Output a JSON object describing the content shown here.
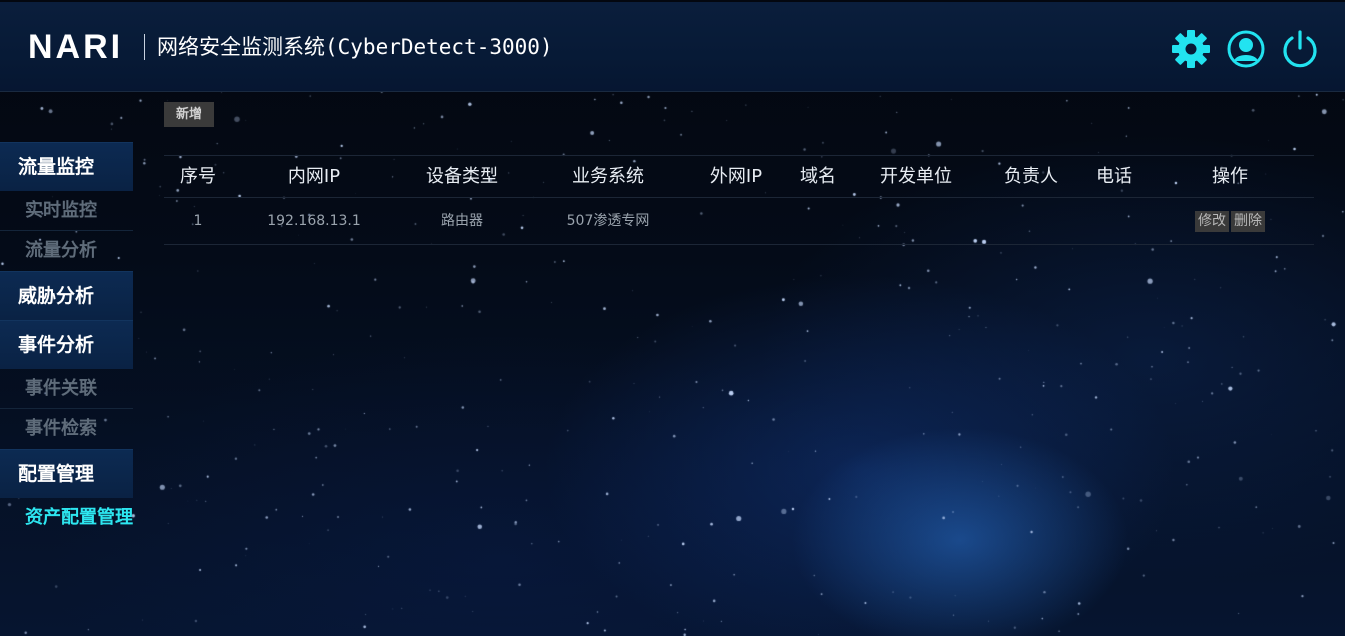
{
  "header": {
    "logo": "NARI",
    "title": "网络安全监测系统(CyberDetect-3000)",
    "icons": [
      "gear-icon",
      "user-icon",
      "power-icon"
    ]
  },
  "sidebar": {
    "groups": [
      {
        "label": "流量监控",
        "items": [
          {
            "label": "实时监控"
          },
          {
            "label": "流量分析"
          }
        ]
      },
      {
        "label": "威胁分析",
        "items": []
      },
      {
        "label": "事件分析",
        "items": [
          {
            "label": "事件关联"
          },
          {
            "label": "事件检索"
          }
        ]
      },
      {
        "label": "配置管理",
        "items": [
          {
            "label": "资产配置管理",
            "active": true
          }
        ]
      }
    ]
  },
  "toolbar": {
    "add_label": "新增"
  },
  "table": {
    "columns": [
      "序号",
      "内网IP",
      "设备类型",
      "业务系统",
      "外网IP",
      "域名",
      "开发单位",
      "负责人",
      "电话",
      "操作"
    ],
    "rows": [
      {
        "index": "1",
        "internal_ip": "192.168.13.1",
        "device_type": "路由器",
        "business_system": "507渗透专网",
        "external_ip": "",
        "domain": "",
        "developer": "",
        "owner": "",
        "phone": "",
        "actions": {
          "edit": "修改",
          "delete": "删除"
        }
      }
    ]
  },
  "colors": {
    "accent": "#2de6f0",
    "nav_bg": "#0a2244",
    "header_bg": "#071a36"
  }
}
